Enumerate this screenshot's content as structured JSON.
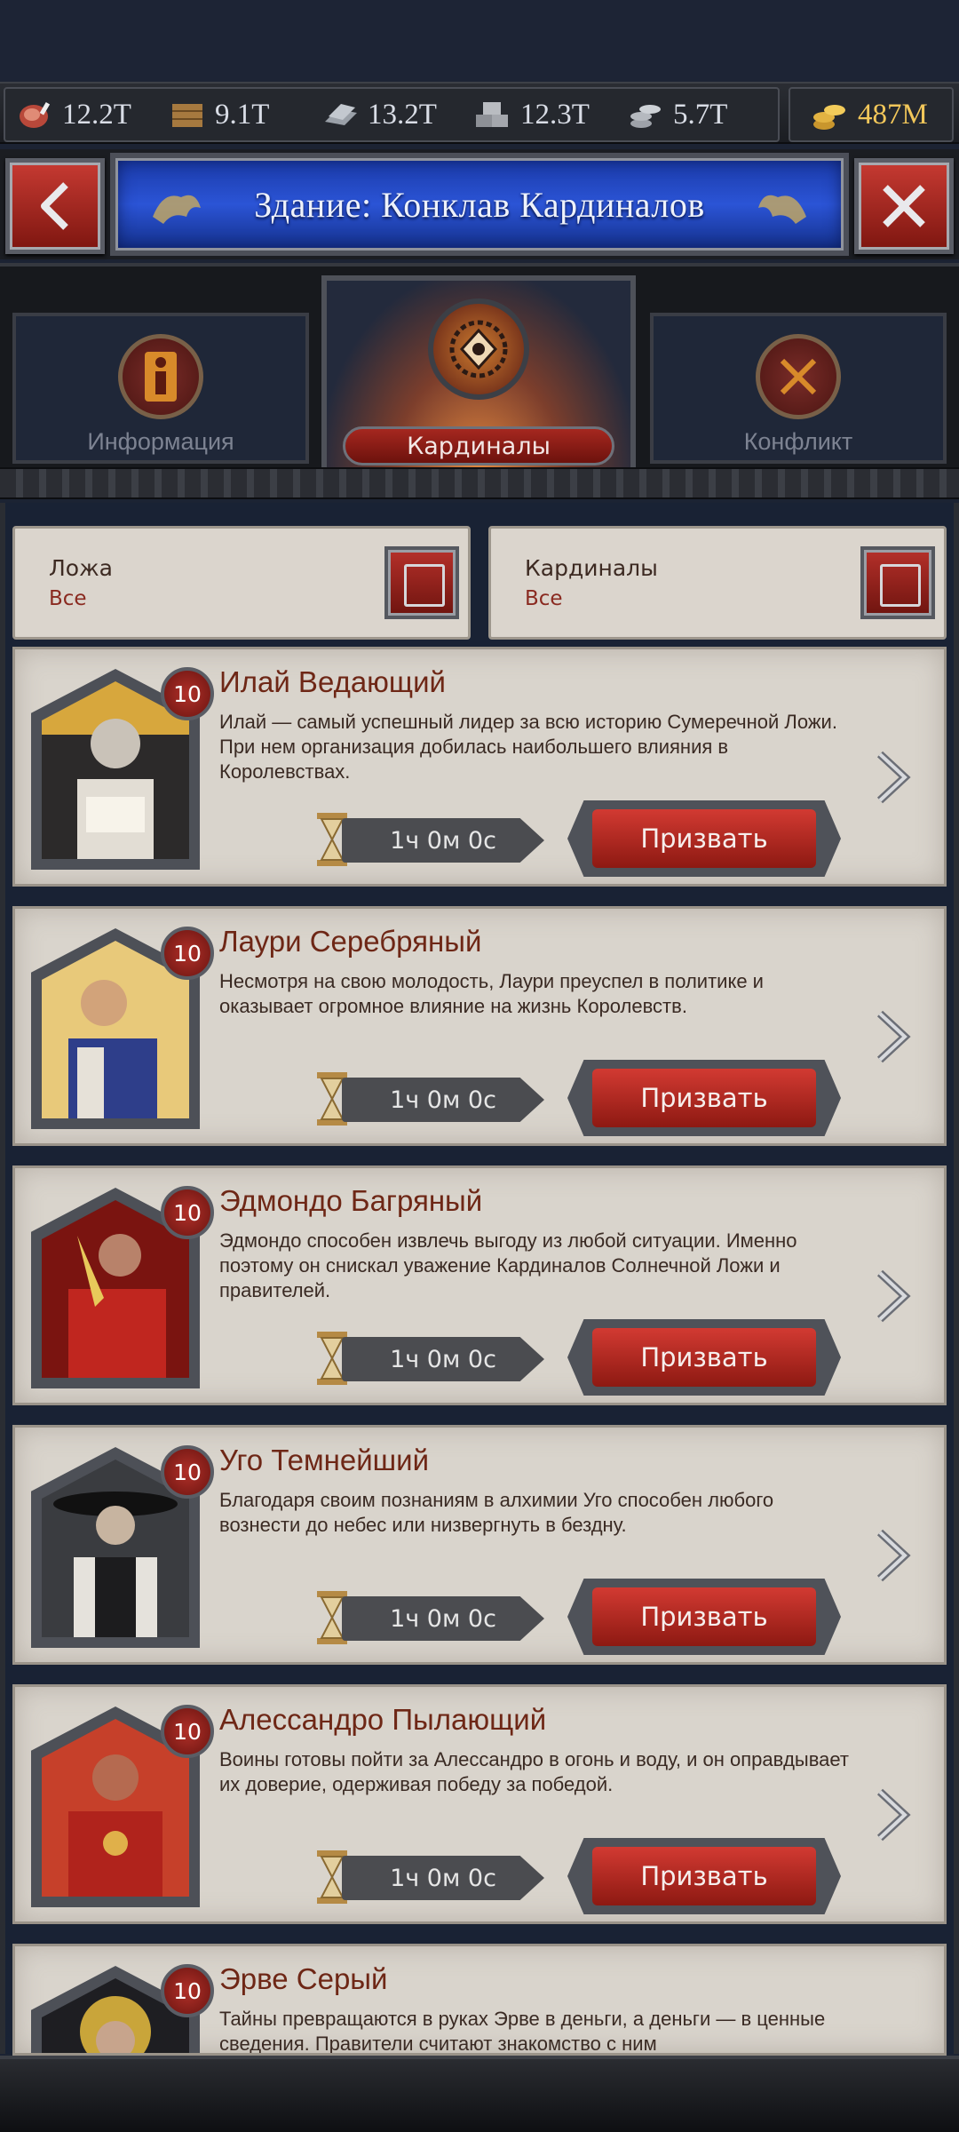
{
  "resources": [
    {
      "icon": "meat-icon",
      "value": "12.2T"
    },
    {
      "icon": "wood-icon",
      "value": "9.1T"
    },
    {
      "icon": "iron-icon",
      "value": "13.2T"
    },
    {
      "icon": "stone-icon",
      "value": "12.3T"
    },
    {
      "icon": "silver-icon",
      "value": "5.7T"
    }
  ],
  "gold": {
    "icon": "gold-coins-icon",
    "value": "487M"
  },
  "header": {
    "title": "Здание: Конклав Кардиналов"
  },
  "tabs": {
    "info": "Информация",
    "cardinals": "Кардиналы",
    "conflict": "Конфликт"
  },
  "filters": [
    {
      "label": "Ложа",
      "value": "Все"
    },
    {
      "label": "Кардиналы",
      "value": "Все"
    }
  ],
  "cards": [
    {
      "name": "Илай Ведающий",
      "level": "10",
      "desc": "Илай — самый успешный лидер за всю историю Сумеречной Ложи. При нем организация добилась наибольшего влияния в Королевствах.",
      "timer": "1ч 0м 0с",
      "button": "Призвать"
    },
    {
      "name": "Лаури Серебряный",
      "level": "10",
      "desc": "Несмотря на свою молодость, Лаури преуспел в политике и оказывает огромное влияние на жизнь Королевств.",
      "timer": "1ч 0м 0с",
      "button": "Призвать"
    },
    {
      "name": "Эдмондо Багряный",
      "level": "10",
      "desc": "Эдмондо способен извлечь выгоду из любой ситуации. Именно поэтому он снискал уважение Кардиналов Солнечной Ложи и правителей.",
      "timer": "1ч 0м 0с",
      "button": "Призвать"
    },
    {
      "name": "Уго Темнейший",
      "level": "10",
      "desc": "Благодаря своим познаниям в алхимии Уго способен любого вознести до небес или низвергнуть в бездну.",
      "timer": "1ч 0м 0с",
      "button": "Призвать"
    },
    {
      "name": "Алессандро Пылающий",
      "level": "10",
      "desc": "Воины готовы пойти за Алессандро в огонь и воду, и он оправдывает их доверие, одерживая победу за победой.",
      "timer": "1ч 0м 0с",
      "button": "Призвать"
    },
    {
      "name": "Эрве Серый",
      "level": "10",
      "desc": "Тайны превращаются в руках Эрве в деньги, а деньги — в ценные сведения. Правители считают знакомство с ним",
      "timer": "",
      "button": ""
    }
  ]
}
